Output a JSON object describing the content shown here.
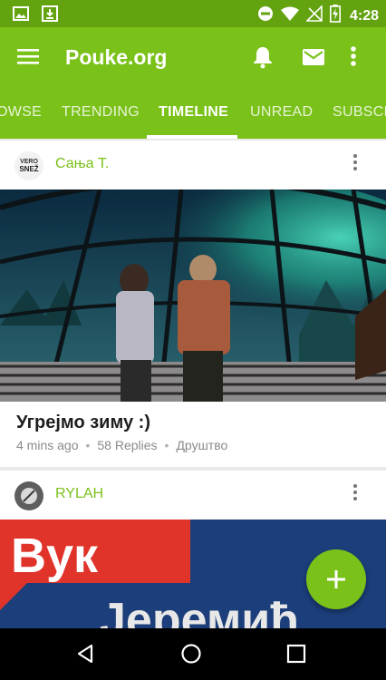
{
  "status_bar": {
    "time": "4:28",
    "icons": [
      "image-icon",
      "download-icon",
      "do-not-disturb-icon",
      "wifi-icon",
      "no-signal-icon",
      "battery-icon"
    ]
  },
  "app_bar": {
    "title": "Pouke.org",
    "icons": [
      "menu-icon",
      "bell-icon",
      "mail-icon",
      "more-vert-icon"
    ]
  },
  "tabs": [
    {
      "label": "OWSE"
    },
    {
      "label": "TRENDING"
    },
    {
      "label": "TIMELINE",
      "active": true
    },
    {
      "label": "UNREAD"
    },
    {
      "label": "SUBSCR"
    }
  ],
  "feed": [
    {
      "author": "Сања Т.",
      "avatar_text": [
        "VERO",
        "SNEŽ"
      ],
      "title": "Угрејмо зиму :)",
      "time": "4 mins ago",
      "replies": "58 Replies",
      "category": "Друштво"
    },
    {
      "author": "RYLAH",
      "image_text_1": "Вук",
      "image_text_2": "Јеремић"
    }
  ],
  "colors": {
    "status_bar": "#63a30f",
    "app_bar": "#7ac11a",
    "accent": "#7ac11a",
    "nav_bar": "#000000"
  }
}
